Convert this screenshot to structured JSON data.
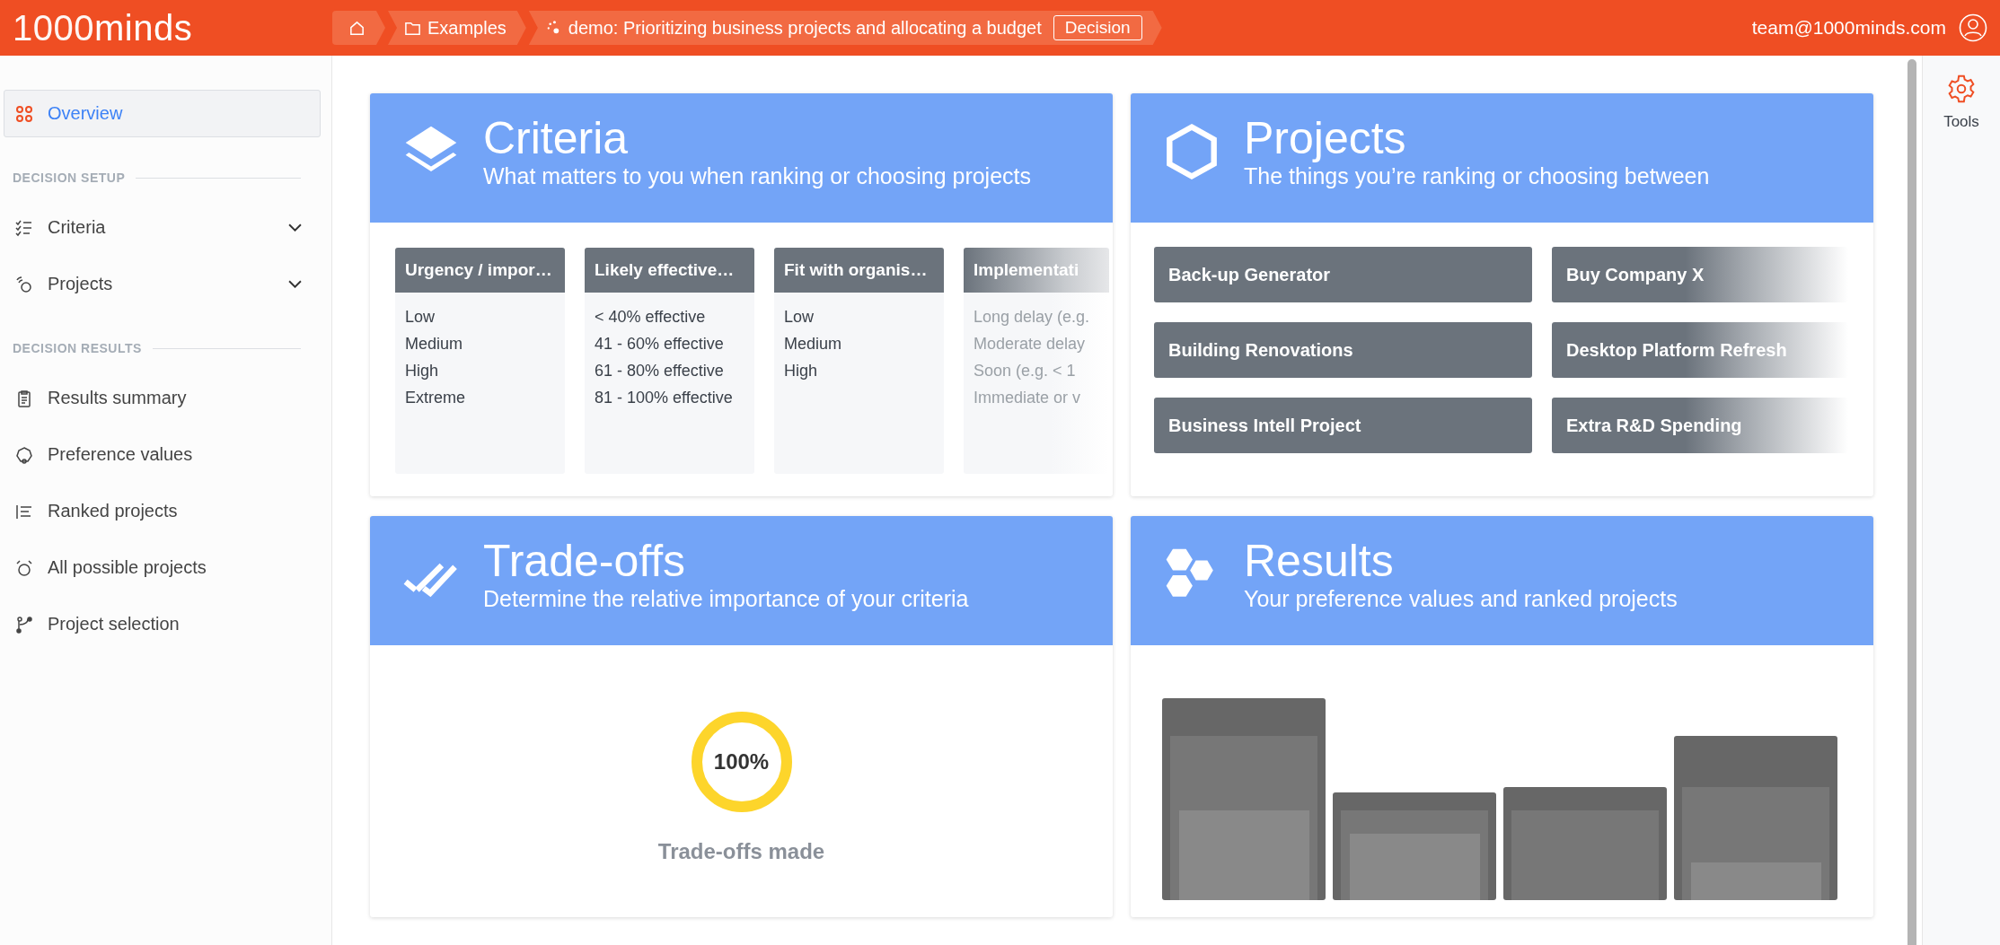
{
  "header": {
    "logo": {
      "number": "1000",
      "word": "minds"
    },
    "breadcrumbs": [
      {
        "kind": "home"
      },
      {
        "kind": "folder",
        "label": "Examples"
      },
      {
        "kind": "decision",
        "label": "demo: Prioritizing business projects and allocating a budget",
        "badge": "Decision"
      }
    ],
    "user": "team@1000minds.com"
  },
  "sidebar": {
    "top": [
      {
        "label": "Overview",
        "selected": true,
        "submenu": false
      }
    ],
    "sections": [
      {
        "title": "DECISION SETUP",
        "items": [
          {
            "label": "Criteria",
            "selected": false,
            "submenu": true
          },
          {
            "label": "Projects",
            "selected": false,
            "submenu": true
          }
        ]
      },
      {
        "title": "DECISION RESULTS",
        "items": [
          {
            "label": "Results summary",
            "selected": false,
            "submenu": false
          },
          {
            "label": "Preference values",
            "selected": false,
            "submenu": false
          },
          {
            "label": "Ranked projects",
            "selected": false,
            "submenu": false
          },
          {
            "label": "All possible projects",
            "selected": false,
            "submenu": false
          },
          {
            "label": "Project selection",
            "selected": false,
            "submenu": false
          }
        ]
      }
    ]
  },
  "cards": [
    {
      "kind": "criteria",
      "title": "Criteria",
      "subtitle": "What matters to you when ranking or choosing projects",
      "columns": [
        {
          "header": "Urgency / impor…",
          "faded": false,
          "items": [
            "Low",
            "Medium",
            "High",
            "Extreme"
          ]
        },
        {
          "header": "Likely effective…",
          "faded": false,
          "items": [
            "< 40% effective",
            "41 - 60% effective",
            "61 - 80% effective",
            "81 - 100% effective"
          ]
        },
        {
          "header": "Fit with organis…",
          "faded": false,
          "items": [
            "Low",
            "Medium",
            "High"
          ]
        },
        {
          "header": "Implementati",
          "faded": true,
          "items": [
            "Long delay (e.g.",
            "Moderate delay",
            "Soon (e.g. < 1",
            "Immediate or v"
          ]
        }
      ]
    },
    {
      "kind": "projects",
      "title": "Projects",
      "subtitle": "The things you’re ranking or choosing between",
      "tiles": [
        {
          "label": "Back-up Generator",
          "faded": false
        },
        {
          "label": "Buy Company X",
          "faded": true
        },
        {
          "label": "Building Renovations",
          "faded": false
        },
        {
          "label": "Desktop Platform Refresh",
          "faded": true
        },
        {
          "label": "Business Intell Project",
          "faded": false
        },
        {
          "label": "Extra R&D Spending",
          "faded": true
        }
      ]
    },
    {
      "kind": "tradeoffs",
      "title": "Trade-offs",
      "subtitle": "Determine the relative importance of your criteria",
      "progress": {
        "level": 1,
        "reading": "100%",
        "caption": "Trade-offs made"
      }
    },
    {
      "kind": "results",
      "title": "Results",
      "subtitle": "Your preference values and ranked projects"
    }
  ],
  "tools": {
    "label": "Tools"
  }
}
